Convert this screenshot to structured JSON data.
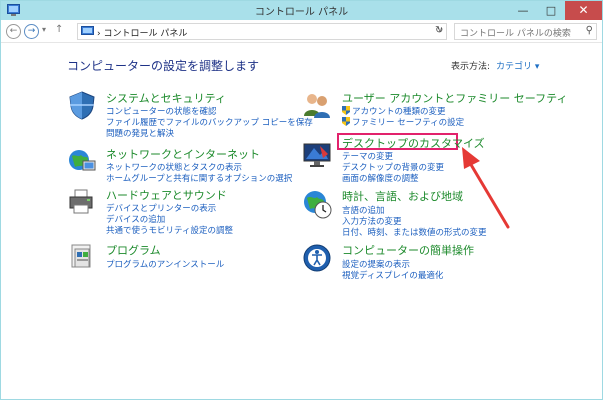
{
  "window": {
    "title": "コントロール パネル",
    "min_glyph": "—",
    "max_glyph": "□",
    "close_glyph": "✕"
  },
  "nav": {
    "back_glyph": "←",
    "forward_glyph": "→",
    "up_glyph": "↑",
    "address": "コントロール パネル",
    "address_dropdown_glyph": "∨",
    "refresh_glyph": "↻",
    "search_placeholder": "コントロール パネルの検索",
    "search_glyph": "⚲"
  },
  "heading": "コンピューターの設定を調整します",
  "view_by": {
    "label": "表示方法:",
    "value": "カテゴリ ▾"
  },
  "categories": {
    "system": {
      "title": "システムとセキュリティ",
      "links": [
        "コンピューターの状態を確認",
        "ファイル履歴でファイルのバックアップ コピーを保存",
        "問題の発見と解決"
      ]
    },
    "network": {
      "title": "ネットワークとインターネット",
      "links": [
        "ネットワークの状態とタスクの表示",
        "ホームグループと共有に関するオプションの選択"
      ]
    },
    "hardware": {
      "title": "ハードウェアとサウンド",
      "links": [
        "デバイスとプリンターの表示",
        "デバイスの追加",
        "共通で使うモビリティ設定の調整"
      ]
    },
    "programs": {
      "title": "プログラム",
      "links": [
        "プログラムのアンインストール"
      ]
    },
    "users": {
      "title": "ユーザー アカウントとファミリー セーフティ",
      "links": [
        "アカウントの種類の変更",
        "ファミリー セーフティの設定"
      ]
    },
    "appearance": {
      "title": "デスクトップのカスタマイズ",
      "links": [
        "テーマの変更",
        "デスクトップの背景の変更",
        "画面の解像度の調整"
      ]
    },
    "clock": {
      "title": "時計、言語、および地域",
      "links": [
        "言語の追加",
        "入力方法の変更",
        "日付、時刻、または数値の形式の変更"
      ]
    },
    "ease": {
      "title": "コンピューターの簡単操作",
      "links": [
        "設定の提案の表示",
        "視覚ディスプレイの最適化"
      ]
    }
  },
  "colors": {
    "titlebar": "#a9e0ea",
    "category_title": "#1c8a2b",
    "link": "#1c5fbf",
    "highlight": "#e2226c",
    "arrow": "#e53935"
  },
  "icons": [
    "control-panel-icon",
    "shield-icon",
    "network-icon",
    "printer-icon",
    "programs-icon",
    "users-icon",
    "desktop-icon",
    "clock-globe-icon",
    "ease-of-access-icon",
    "uac-shield-icon",
    "red-arrow-icon"
  ]
}
